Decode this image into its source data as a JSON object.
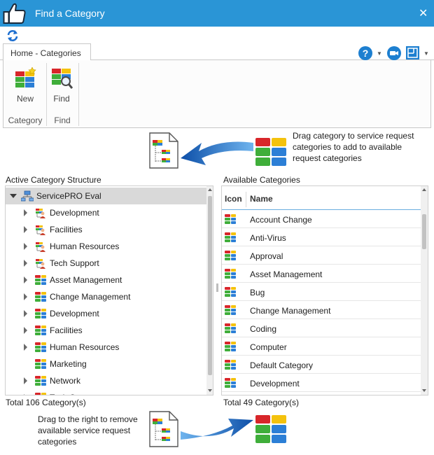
{
  "window": {
    "title": "Find a Category",
    "close_glyph": "✕"
  },
  "ribbon": {
    "tab": "Home - Categories",
    "groups": [
      {
        "label": "Category",
        "button": "New"
      },
      {
        "label": "Find",
        "button": "Find"
      }
    ],
    "help_glyph": "?"
  },
  "instructions": {
    "top": "Drag category to service request categories to add to available request categories",
    "bottom": "Drag to the right to remove available service request categories"
  },
  "tree": {
    "header": "Active Category Structure",
    "root": "ServicePRO Eval",
    "items": [
      {
        "label": "Development",
        "icon": "folder-user-icon",
        "expandable": true
      },
      {
        "label": "Facilities",
        "icon": "folder-user-icon",
        "expandable": true
      },
      {
        "label": "Human Resources",
        "icon": "folder-user-icon",
        "expandable": true
      },
      {
        "label": "Tech Support",
        "icon": "folder-user-icon",
        "expandable": true
      },
      {
        "label": "Asset Management",
        "icon": "category-icon",
        "expandable": true
      },
      {
        "label": "Change Management",
        "icon": "category-icon",
        "expandable": true
      },
      {
        "label": "Development",
        "icon": "category-icon",
        "expandable": true
      },
      {
        "label": "Facilities",
        "icon": "category-icon",
        "expandable": true
      },
      {
        "label": "Human Resources",
        "icon": "category-icon",
        "expandable": true
      },
      {
        "label": "Marketing",
        "icon": "category-icon",
        "expandable": false
      },
      {
        "label": "Network",
        "icon": "category-icon",
        "expandable": true
      },
      {
        "label": "Tech Support",
        "icon": "category-icon",
        "expandable": true
      }
    ],
    "total": "Total 106 Category(s)"
  },
  "grid": {
    "header": "Available Categories",
    "columns": [
      "Icon",
      "Name"
    ],
    "rows": [
      "Account Change",
      "Anti-Virus",
      "Approval",
      "Asset Management",
      "Bug",
      "Change Management",
      "Coding",
      "Computer",
      "Default Category",
      "Development"
    ],
    "total": "Total 49 Category(s)"
  },
  "colors": {
    "titlebar": "#2a95d6",
    "accent": "#1d7fd0",
    "cat_red": "#d8262a",
    "cat_yellow": "#f4c20d",
    "cat_green": "#3fae3a",
    "cat_blue": "#2c7fd6"
  }
}
